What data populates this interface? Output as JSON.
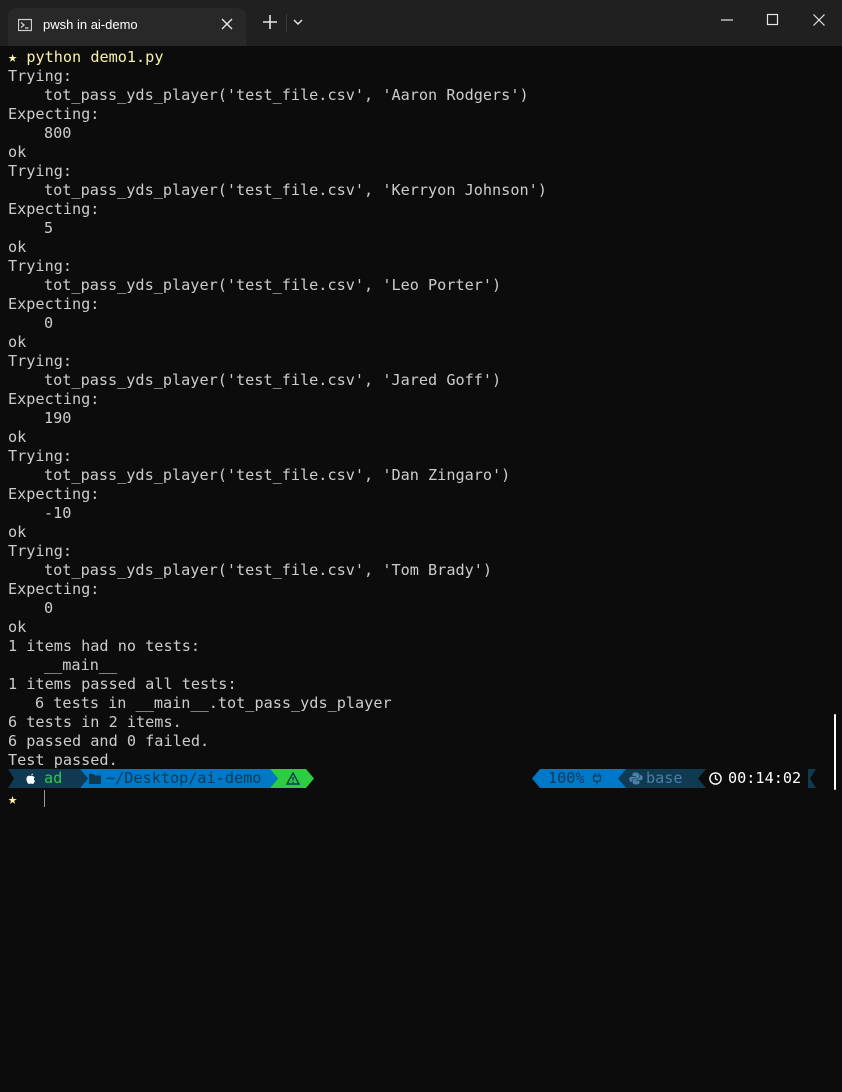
{
  "window": {
    "tab_title": "pwsh in ai-demo",
    "tab_icon": "powershell-icon",
    "new_tab_icon": "plus-icon",
    "dropdown_icon": "chevron-down-icon",
    "controls": [
      "minimize-icon",
      "maximize-icon",
      "close-icon"
    ]
  },
  "terminal": {
    "command_prompt_glyph": "★",
    "command": "python demo1.py",
    "lines": [
      "Trying:",
      "tot_pass_yds_player('test_file.csv', 'Aaron Rodgers')",
      "Expecting:",
      "800",
      "ok",
      "Trying:",
      "tot_pass_yds_player('test_file.csv', 'Kerryon Johnson')",
      "Expecting:",
      "5",
      "ok",
      "Trying:",
      "tot_pass_yds_player('test_file.csv', 'Leo Porter')",
      "Expecting:",
      "0",
      "ok",
      "Trying:",
      "tot_pass_yds_player('test_file.csv', 'Jared Goff')",
      "Expecting:",
      "190",
      "ok",
      "Trying:",
      "tot_pass_yds_player('test_file.csv', 'Dan Zingaro')",
      "Expecting:",
      "-10",
      "ok",
      "Trying:",
      "tot_pass_yds_player('test_file.csv', 'Tom Brady')",
      "Expecting:",
      "0",
      "ok",
      "1 items had no tests:",
      "__main__",
      "1 items passed all tests:",
      "6 tests in __main__.tot_pass_yds_player",
      "6 tests in 2 items.",
      "6 passed and 0 failed.",
      "Test passed."
    ]
  },
  "prompt_bar": {
    "os_icon": "apple-icon",
    "user": "ad",
    "folder_icon": "folder-icon",
    "path": "~/Desktop/ai-demo",
    "warning_icon": "warning-icon",
    "battery": "100%",
    "plug_icon": "plug-icon",
    "python_icon": "python-icon",
    "env": "base",
    "clock_icon": "clock-icon",
    "time": "00:14:02",
    "colors": {
      "user_segment": "#0f3a52",
      "path_segment": "#0078c8",
      "status_segment": "#2ecc40",
      "battery_segment": "#0078c8",
      "env_segment": "#0f3a52",
      "time_segment": "#0c0c0c"
    }
  },
  "next_prompt_glyph": "★"
}
